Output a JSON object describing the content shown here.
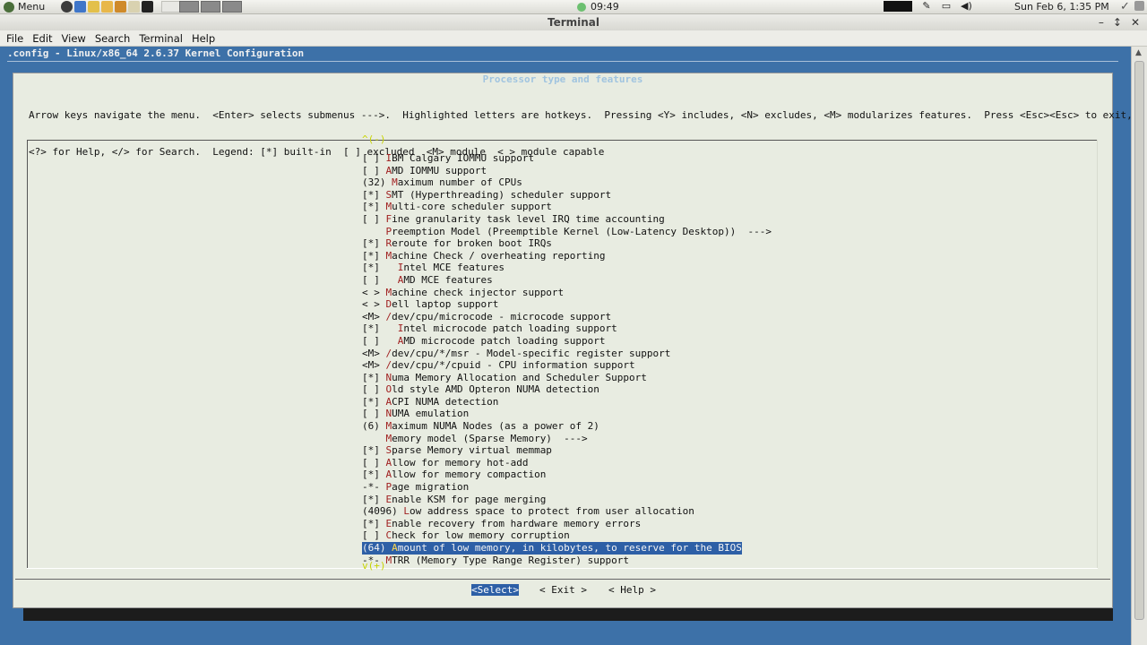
{
  "panel": {
    "menu_label": "Menu",
    "clock": "09:49",
    "date": "Sun Feb  6,  1:35 PM"
  },
  "window": {
    "title": "Terminal",
    "minimize": "–",
    "maximize": "↕",
    "close": "✕"
  },
  "menubar": [
    "File",
    "Edit",
    "View",
    "Search",
    "Terminal",
    "Help"
  ],
  "config": {
    "header": ".config - Linux/x86_64 2.6.37 Kernel Configuration",
    "dialog_title": "Processor type and features",
    "help_line1": "Arrow keys navigate the menu.  <Enter> selects submenus --->.  Highlighted letters are hotkeys.  Pressing <Y> includes, <N> excludes, <M> modularizes features.  Press <Esc><Esc> to exit,",
    "help_line2": "<?> for Help, </> for Search.  Legend: [*] built-in  [ ] excluded  <M> module  < > module capable",
    "top_marker": "^(-)",
    "bottom_marker": "v(+)",
    "items": [
      {
        "prefix": "[ ] ",
        "hot": "I",
        "rest": "BM Calgary IOMMU support"
      },
      {
        "prefix": "[ ] ",
        "hot": "A",
        "rest": "MD IOMMU support"
      },
      {
        "prefix": "(32) ",
        "hot": "M",
        "rest": "aximum number of CPUs"
      },
      {
        "prefix": "[*] ",
        "hot": "S",
        "rest": "MT (Hyperthreading) scheduler support"
      },
      {
        "prefix": "[*] ",
        "hot": "M",
        "rest": "ulti-core scheduler support"
      },
      {
        "prefix": "[ ] ",
        "hot": "F",
        "rest": "ine granularity task level IRQ time accounting"
      },
      {
        "prefix": "    ",
        "hot": "P",
        "rest": "reemption Model (Preemptible Kernel (Low-Latency Desktop))  --->"
      },
      {
        "prefix": "[*] ",
        "hot": "R",
        "rest": "eroute for broken boot IRQs"
      },
      {
        "prefix": "[*] ",
        "hot": "M",
        "rest": "achine Check / overheating reporting"
      },
      {
        "prefix": "[*]   ",
        "hot": "I",
        "rest": "ntel MCE features"
      },
      {
        "prefix": "[ ]   ",
        "hot": "A",
        "rest": "MD MCE features"
      },
      {
        "prefix": "< > ",
        "hot": "M",
        "rest": "achine check injector support"
      },
      {
        "prefix": "< > ",
        "hot": "D",
        "rest": "ell laptop support"
      },
      {
        "prefix": "<M> ",
        "hot": "/",
        "rest": "dev/cpu/microcode - microcode support"
      },
      {
        "prefix": "[*]   ",
        "hot": "I",
        "rest": "ntel microcode patch loading support"
      },
      {
        "prefix": "[ ]   ",
        "hot": "A",
        "rest": "MD microcode patch loading support"
      },
      {
        "prefix": "<M> ",
        "hot": "/",
        "rest": "dev/cpu/*/msr - Model-specific register support"
      },
      {
        "prefix": "<M> ",
        "hot": "/",
        "rest": "dev/cpu/*/cpuid - CPU information support"
      },
      {
        "prefix": "[*] ",
        "hot": "N",
        "rest": "uma Memory Allocation and Scheduler Support"
      },
      {
        "prefix": "[ ] ",
        "hot": "O",
        "rest": "ld style AMD Opteron NUMA detection"
      },
      {
        "prefix": "[*] ",
        "hot": "A",
        "rest": "CPI NUMA detection"
      },
      {
        "prefix": "[ ] ",
        "hot": "N",
        "rest": "UMA emulation"
      },
      {
        "prefix": "(6) ",
        "hot": "M",
        "rest": "aximum NUMA Nodes (as a power of 2)"
      },
      {
        "prefix": "    ",
        "hot": "M",
        "rest": "emory model (Sparse Memory)  --->"
      },
      {
        "prefix": "[*] ",
        "hot": "S",
        "rest": "parse Memory virtual memmap"
      },
      {
        "prefix": "[ ] ",
        "hot": "A",
        "rest": "llow for memory hot-add"
      },
      {
        "prefix": "[*] ",
        "hot": "A",
        "rest": "llow for memory compaction"
      },
      {
        "prefix": "-*- ",
        "hot": "P",
        "rest": "age migration"
      },
      {
        "prefix": "[*] ",
        "hot": "E",
        "rest": "nable KSM for page merging"
      },
      {
        "prefix": "(4096) ",
        "hot": "L",
        "rest": "ow address space to protect from user allocation"
      },
      {
        "prefix": "[*] ",
        "hot": "E",
        "rest": "nable recovery from hardware memory errors"
      },
      {
        "prefix": "[ ] ",
        "hot": "C",
        "rest": "heck for low memory corruption"
      },
      {
        "prefix": "(64) ",
        "hot": "A",
        "rest": "mount of low memory, in kilobytes, to reserve for the BIOS",
        "selected": true
      },
      {
        "prefix": "-*- ",
        "hot": "M",
        "rest": "TRR (Memory Type Range Register) support"
      }
    ],
    "buttons": {
      "select": "<Select>",
      "exit": "< Exit >",
      "help": "< Help >"
    }
  }
}
